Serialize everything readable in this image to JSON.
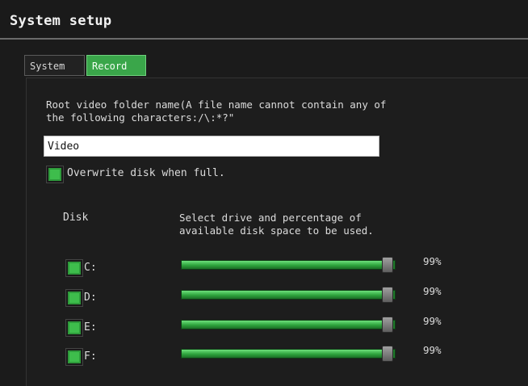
{
  "window": {
    "title": "System setup"
  },
  "tabs": [
    {
      "label": "System",
      "active": false
    },
    {
      "label": "Record",
      "active": true
    }
  ],
  "record": {
    "folder_description": "Root video folder name(A file name cannot contain any of\nthe following characters:/\\:*?\"",
    "folder_name_value": "Video",
    "overwrite": {
      "label": "Overwrite disk when full.",
      "checked": true
    },
    "disk_header": "Disk",
    "select_header": "Select drive and percentage of\navailable disk space to be used.",
    "drives": [
      {
        "label": "C:",
        "checked": true,
        "percent_text": "99%",
        "percent": 99
      },
      {
        "label": "D:",
        "checked": true,
        "percent_text": "99%",
        "percent": 99
      },
      {
        "label": "E:",
        "checked": true,
        "percent_text": "99%",
        "percent": 99
      },
      {
        "label": "F:",
        "checked": true,
        "percent_text": "99%",
        "percent": 99
      }
    ]
  },
  "colors": {
    "accent_green": "#3aa64a",
    "background": "#1b1b1b"
  }
}
